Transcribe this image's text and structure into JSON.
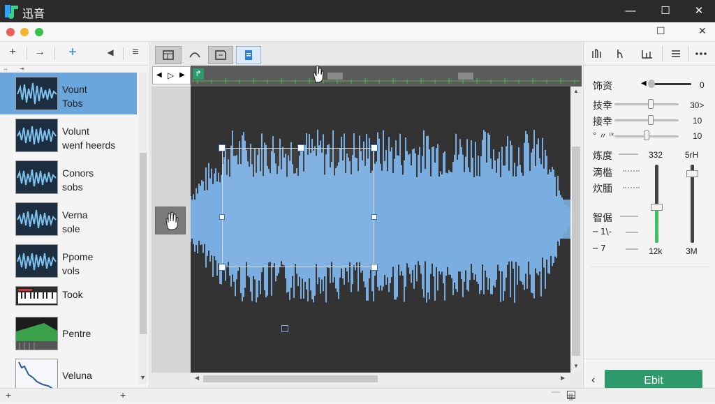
{
  "app": {
    "title": "迅音"
  },
  "window_controls": {
    "minimize": "—",
    "maximize": "☐",
    "close": "✕"
  },
  "inner_controls": {
    "maximize": "☐",
    "close": "✕"
  },
  "left_toolbar": {
    "add": "+",
    "forward": "→",
    "add_track": "+",
    "speaker": "◀",
    "filter": "≡"
  },
  "left_subbar": {
    "left": "↔",
    "right": "⇥"
  },
  "clips": [
    {
      "line1": "Vount",
      "line2": "Tobs",
      "thumb": "waveform"
    },
    {
      "line1": "Volunt",
      "line2": "wenf heerds",
      "thumb": "waveform"
    },
    {
      "line1": "Conors",
      "line2": "sobs",
      "thumb": "waveform"
    },
    {
      "line1": "Verna",
      "line2": "sole",
      "thumb": "waveform"
    },
    {
      "line1": "Ppome",
      "line2": "vols",
      "thumb": "waveform"
    },
    {
      "line1": "Took",
      "line2": "",
      "thumb": "keyboard"
    },
    {
      "line1": "Pentre",
      "line2": "",
      "thumb": "mixer"
    },
    {
      "line1": "Veluna",
      "line2": "",
      "thumb": "curve"
    }
  ],
  "left_footer": {
    "plus": "+"
  },
  "center_toolbar": [
    "trim-icon",
    "fade-icon",
    "split-icon",
    "page-icon"
  ],
  "transport": {
    "prev": "◀",
    "play": "▷",
    "next": "▶"
  },
  "timeline_marker": "↱",
  "scroll": {
    "up": "▲",
    "down": "▼",
    "left": "◀",
    "right": "▶"
  },
  "right_toolbar": [
    "meter-icon-1",
    "meter-icon-2",
    "meter-icon-3",
    "list-icon",
    "more-icon"
  ],
  "right_panel": {
    "row1": {
      "label": "饰资",
      "value": "0"
    },
    "row2": {
      "label": "技幸",
      "value": "30>"
    },
    "row3": {
      "label": "接幸",
      "value": "10"
    },
    "row4": {
      "label": "° 〃 ⁽ᵏ",
      "value": "10"
    },
    "label5": "炼度",
    "label6": "滴槛",
    "label7": "炊腼",
    "label8": "智倨",
    "label9": "─ 1\\-",
    "label10": "─ 7",
    "fader_left_top": "332",
    "fader_right_top": "5rH",
    "fader_left_bottom": "12k",
    "fader_right_bottom": "3M"
  },
  "right_footer": {
    "back": "‹",
    "edit": "Ebit"
  },
  "colors": {
    "accent": "#2e9a6c",
    "wave": "#7aaee0",
    "selected": "#6aa6dc"
  }
}
